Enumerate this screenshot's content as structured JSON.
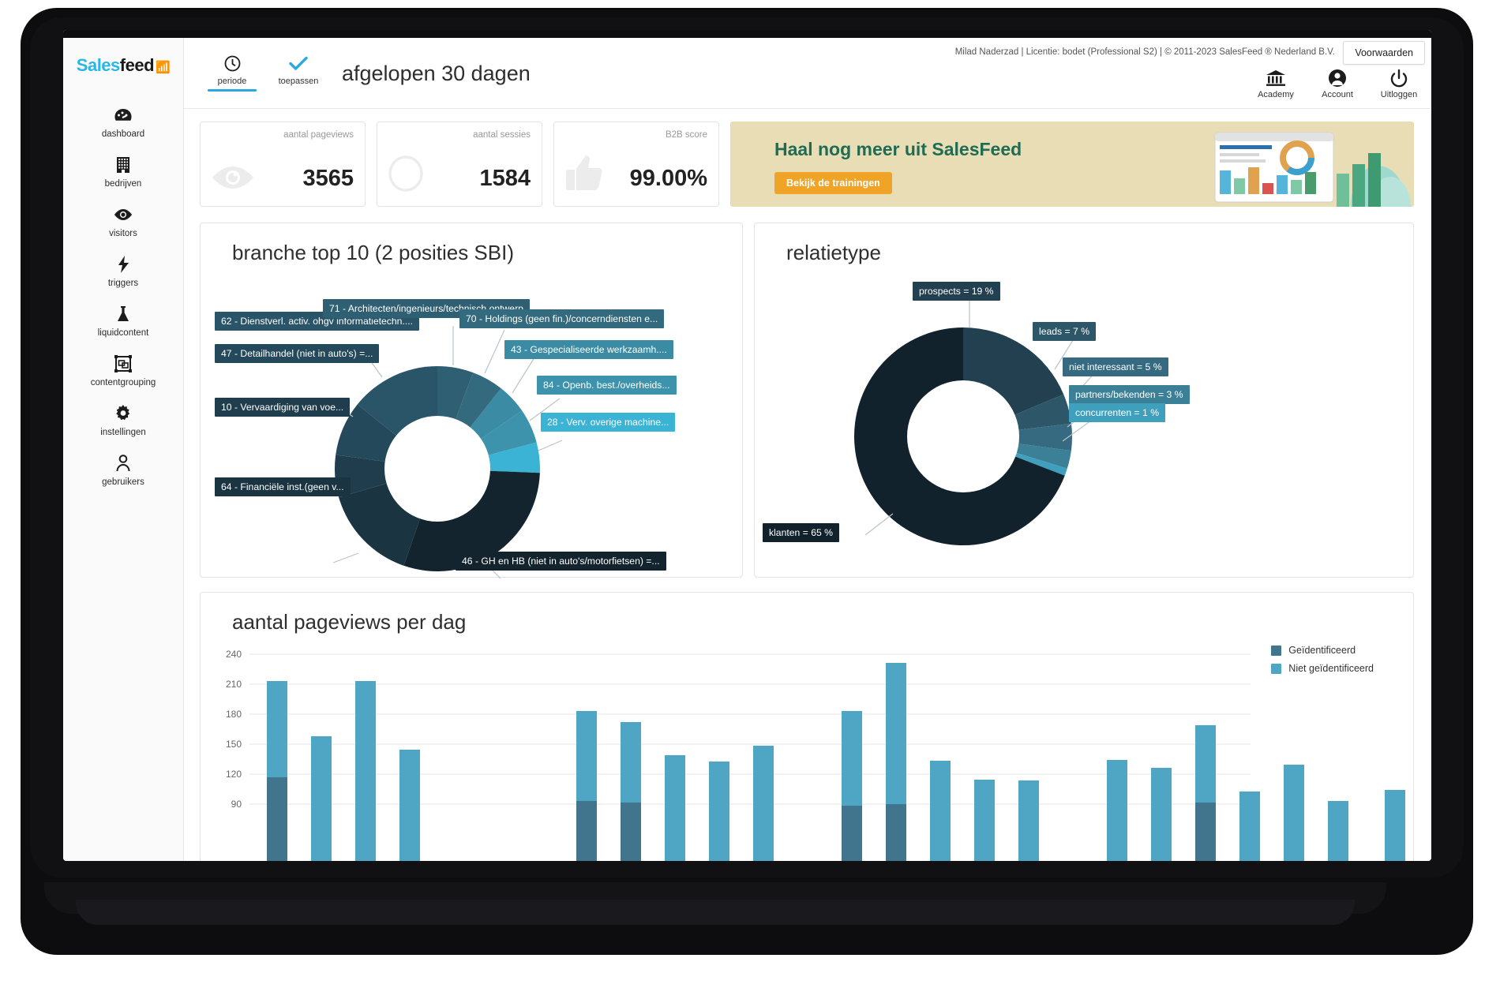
{
  "brand": {
    "name_part1": "Sales",
    "name_part2": "feed",
    "wifi_icon": "wifi-icon"
  },
  "sidebar": {
    "items": [
      {
        "label": "dashboard",
        "icon": "dashboard-icon"
      },
      {
        "label": "bedrijven",
        "icon": "building-icon"
      },
      {
        "label": "visitors",
        "icon": "eye-icon"
      },
      {
        "label": "triggers",
        "icon": "bolt-icon"
      },
      {
        "label": "liquidcontent",
        "icon": "flask-icon"
      },
      {
        "label": "contentgrouping",
        "icon": "group-icon"
      },
      {
        "label": "instellingen",
        "icon": "gear-icon"
      },
      {
        "label": "gebruikers",
        "icon": "user-icon"
      }
    ]
  },
  "header": {
    "license_text": "Milad Naderzad | Licentie: bodet (Professional S2) | © 2011-2023 SalesFeed ® Nederland B.V.",
    "voorwaarden_label": "Voorwaarden",
    "period_tabs": [
      {
        "label": "periode",
        "icon": "clock-icon",
        "active": true
      },
      {
        "label": "toepassen",
        "icon": "check-icon",
        "active": false
      }
    ],
    "page_title": "afgelopen 30 dagen",
    "right_items": [
      {
        "label": "Academy",
        "icon": "bank-icon"
      },
      {
        "label": "Account",
        "icon": "account-icon"
      },
      {
        "label": "Uitloggen",
        "icon": "power-icon"
      }
    ]
  },
  "kpis": [
    {
      "label": "aantal pageviews",
      "value": "3565",
      "icon": "eye-icon"
    },
    {
      "label": "aantal sessies",
      "value": "1584",
      "icon": "circle-icon"
    },
    {
      "label": "B2B score",
      "value": "99.00%",
      "icon": "thumbs-up-icon"
    }
  ],
  "promo": {
    "title": "Haal nog meer uit SalesFeed",
    "button_label": "Bekijk de trainingen",
    "bg_color": "#e8ddb5",
    "title_color": "#1f6b53",
    "button_color": "#f0a427"
  },
  "chart_data": [
    {
      "type": "pie",
      "id": "branche-top-10",
      "title": "branche top 10 (2 posities SBI)",
      "legend_position": "callout-labels",
      "categories": [
        "71 - Architecten/ingenieurs/technisch ontwerp",
        "70 - Holdings (geen fin.)/concerndiensten e...",
        "43 - Gespecialiseerde werkzaamh....",
        "84 - Openb. best./overheids...",
        "28 - Verv. overige machine...",
        "46 - GH en HB (niet in auto's/motorfietsen) =...",
        "64 - Financiële inst.(geen v...",
        "10 - Vervaardiging van voe...",
        "47 - Detailhandel (niet in auto's) =...",
        "62 - Dienstverl. activ. ohgv informatietechn...."
      ],
      "values": [
        9,
        8,
        7,
        7,
        6,
        22,
        14,
        9,
        9,
        9
      ],
      "colors": [
        "#2e5f72",
        "#346a7d",
        "#3a8ba3",
        "#3d93ac",
        "#3bb3d4",
        "#13242f",
        "#1b3442",
        "#1f3d4c",
        "#24495a",
        "#2a5468"
      ]
    },
    {
      "type": "pie",
      "id": "relatietype",
      "title": "relatietype",
      "legend_position": "callout-labels",
      "categories": [
        "prospects",
        "leads",
        "niet interessant",
        "partners/bekenden",
        "concurrenten",
        "klanten"
      ],
      "values": [
        19,
        7,
        5,
        3,
        1,
        65
      ],
      "labels": [
        "prospects = 19 %",
        "leads = 7 %",
        "niet interessant = 5 %",
        "partners/bekenden = 3 %",
        "concurrenten = 1 %",
        "klanten = 65 %"
      ],
      "colors": [
        "#22404f",
        "#2d5668",
        "#356a80",
        "#3c8097",
        "#3fa0bd",
        "#12222c"
      ]
    },
    {
      "type": "bar",
      "id": "pageviews-per-dag",
      "title": "aantal pageviews per dag",
      "stacked": true,
      "ylabel": "",
      "xlabel": "",
      "ylim": [
        90,
        240
      ],
      "yticks": [
        90,
        120,
        150,
        180,
        210,
        240
      ],
      "series": [
        {
          "name": "Geïdentificeerd",
          "color": "#41758d",
          "values": [
            118,
            0,
            0,
            0,
            0,
            0,
            0,
            0,
            0,
            0,
            100,
            101,
            0,
            0,
            0,
            0,
            0,
            0,
            92,
            0,
            0,
            0,
            0,
            0,
            0,
            0,
            93,
            0,
            0,
            0,
            0,
            0
          ]
        },
        {
          "name": "Niet geïdentificeerd",
          "color": "#4ea6c4",
          "values": [
            213,
            0,
            159,
            0,
            213,
            0,
            146,
            0,
            0,
            0,
            184,
            172,
            0,
            141,
            135,
            0,
            150,
            0,
            0,
            183,
            233,
            0,
            136,
            117,
            117,
            0,
            0,
            135,
            125,
            0,
            170,
            103,
            130,
            0,
            95,
            0,
            105
          ]
        }
      ],
      "legend": [
        "Geïdentificeerd",
        "Niet geïdentificeerd"
      ]
    }
  ]
}
